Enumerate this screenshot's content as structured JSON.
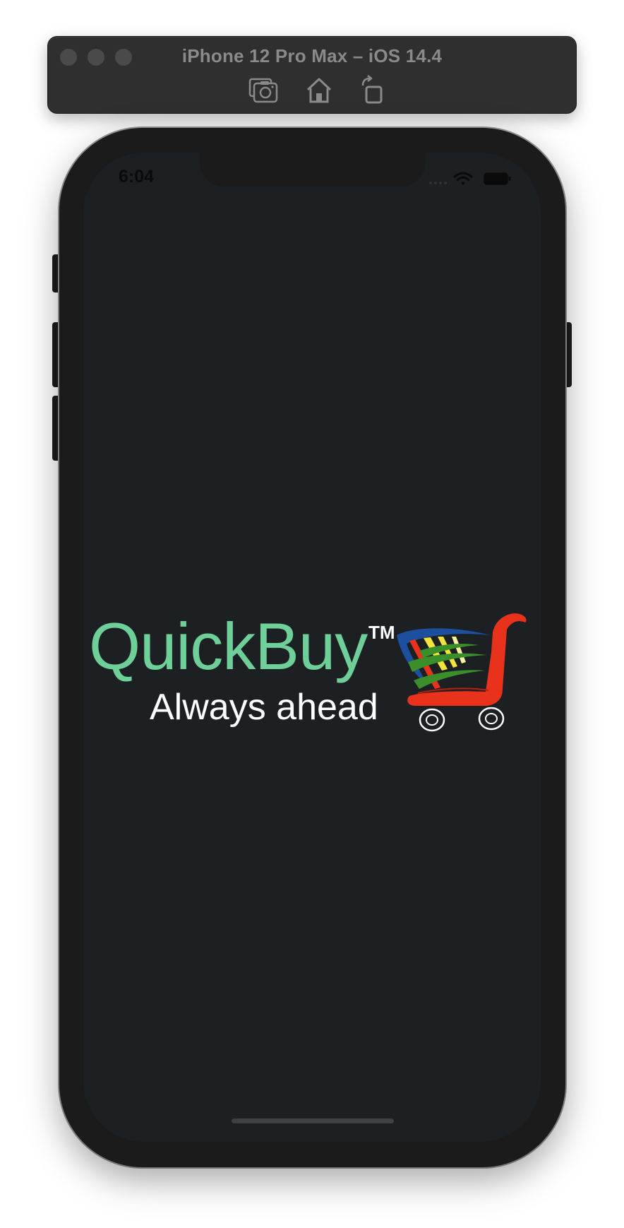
{
  "simulator": {
    "title": "iPhone 12 Pro Max – iOS 14.4",
    "toolbar": {
      "screenshot_icon": "camera-icon",
      "home_icon": "home-icon",
      "rotate_icon": "rotate-icon"
    }
  },
  "status_bar": {
    "time": "6:04",
    "wifi_icon": "wifi-icon",
    "battery_icon": "battery-icon"
  },
  "splash": {
    "brand": "QuickBuy",
    "trademark": "TM",
    "tagline": "Always ahead",
    "cart_icon": "shopping-cart-icon",
    "colors": {
      "background": "#1c2023",
      "brand": "#6fcf99",
      "tagline": "#ffffff",
      "cart_red": "#e8321c",
      "cart_blue": "#1c4f9e",
      "cart_yellow": "#f4e43a",
      "cart_green": "#3a8f2a"
    }
  }
}
